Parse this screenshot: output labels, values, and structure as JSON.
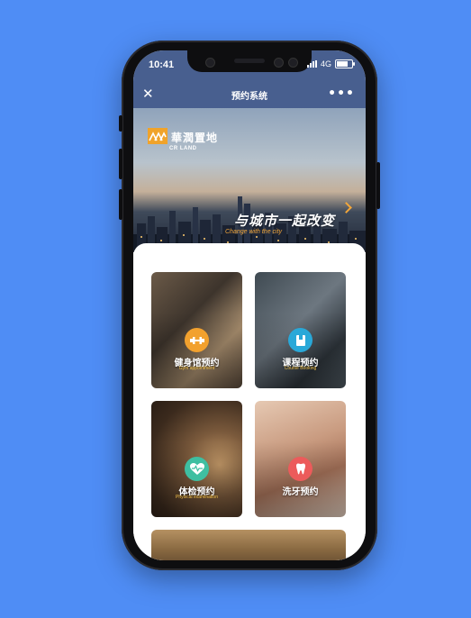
{
  "status_bar": {
    "time": "10:41",
    "network": "4G"
  },
  "navbar": {
    "close_icon": "✕",
    "title": "预约系统",
    "more_icon": "•••"
  },
  "banner": {
    "logo_cn": "華潤置地",
    "logo_en": "CR LAND",
    "slogan_cn": "与城市一起改变",
    "slogan_en": "Change with the city"
  },
  "services": [
    {
      "label_cn": "健身馆预约",
      "label_en": "Gym appointment",
      "icon": "dumbbell-icon",
      "icon_color": "#f2a12e"
    },
    {
      "label_cn": "课程预约",
      "label_en": "Course Booking",
      "icon": "book-icon",
      "icon_color": "#29a8d8"
    },
    {
      "label_cn": "体检预约",
      "label_en": "Physical examination",
      "icon": "heart-pulse-icon",
      "icon_color": "#3ebfa1"
    },
    {
      "label_cn": "洗牙预约",
      "label_en": "",
      "icon": "tooth-icon",
      "icon_color": "#ec5b5b"
    }
  ],
  "colors": {
    "background": "#4f8df5",
    "navbar": "#485f8f",
    "accent": "#f2a63a"
  }
}
